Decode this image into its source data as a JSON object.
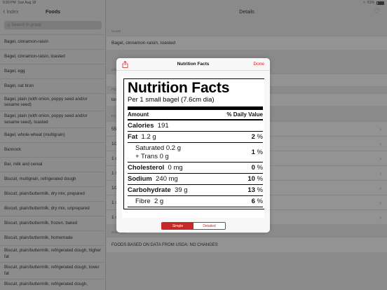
{
  "status": {
    "time": "9:20 PM",
    "date": "Sun Aug 18",
    "battery": "61%"
  },
  "sidebar": {
    "back_label": "Index",
    "title": "Foods",
    "search_placeholder": "Search in group",
    "items": [
      "Bagel, cinnamon-raisin",
      "Bagel, cinnamon-raisin, toasted",
      "Bagel, egg",
      "Bagel, oat bran",
      "Bagel, plain (with onion, poppy seed and/or sesame seed)",
      "Bagel, plain (with onion, poppy seed and/or sesame seed), toasted",
      "Bagel, whole-wheat (multigrain)",
      "Bannock",
      "Bar, milk and cereal",
      "Biscuit, multigrain, refrigerated dough",
      "Biscuit, plain/buttermilk, dry mix, prepared",
      "Biscuit, plain/buttermilk, dry mix, unprepared",
      "Biscuit, plain/buttermilk, frozen, baked",
      "Biscuit, plain/buttermilk, homemade",
      "Biscuit, plain/buttermilk, refrigerated dough, higher fat",
      "Biscuit, plain/buttermilk, refrigerated dough, lower fat",
      "Biscuit, plain/buttermilk, refrigerated dough,"
    ]
  },
  "detail": {
    "title": "Details",
    "name_label": "NAME",
    "name_value": "Bagel, cinnamon-raisin, toasted",
    "group_label_partial": "GR",
    "foods_label_partial": "FO",
    "foods_label_partial2": "PO",
    "row_tos": "tos",
    "rows_partial": [
      "55",
      "1/2",
      "1 c",
      "1 s",
      "1/2",
      "1 s",
      "1 s"
    ],
    "source_label": "SOURCE",
    "source_value": "FOODS BASED ON DATA FROM USDA: NO CHANGES"
  },
  "modal": {
    "title": "Nutrition Facts",
    "done_label": "Done",
    "label_title": "Nutrition Facts",
    "serving": "Per 1 small bagel (7.6cm dia)",
    "header_amount": "Amount",
    "header_dv": "% Daily Value",
    "rows": {
      "calories_name": "Calories",
      "calories_value": "191",
      "fat_name": "Fat",
      "fat_value": "1.2 g",
      "fat_pct": "2",
      "sat_name": "Saturated",
      "sat_value": "0.2 g",
      "trans_name": "+ Trans",
      "trans_value": "0 g",
      "sat_pct": "1",
      "chol_name": "Cholesterol",
      "chol_value": "0 mg",
      "chol_pct": "0",
      "sodium_name": "Sodium",
      "sodium_value": "240 mg",
      "sodium_pct": "10",
      "carb_name": "Carbohydrate",
      "carb_value": "39 g",
      "carb_pct": "13",
      "fibre_name": "Fibre",
      "fibre_value": "2 g",
      "fibre_pct": "6"
    },
    "pct_sign": "%",
    "segments": {
      "simple": "Simple",
      "detailed": "Detailed"
    }
  },
  "colors": {
    "accent": "#c62828"
  }
}
